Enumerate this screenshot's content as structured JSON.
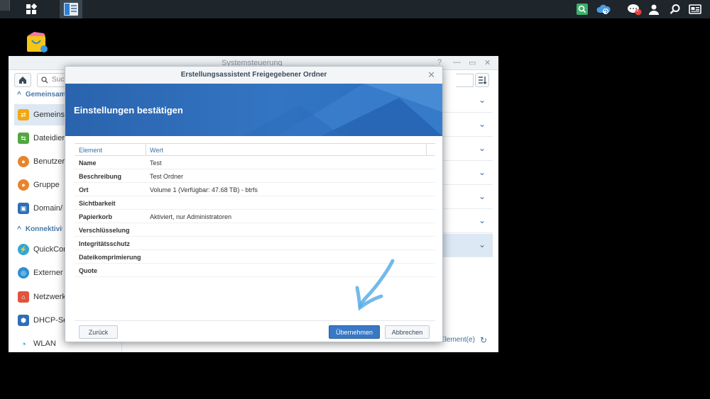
{
  "taskbar": {
    "apps_icon": "grid-icon",
    "control_panel_icon": "control-panel-icon",
    "notification_count": "1",
    "right_icons": [
      "search-app-icon",
      "cloud-sync-icon",
      "notifications-icon",
      "user-icon",
      "search-icon",
      "widgets-icon"
    ]
  },
  "window": {
    "title": "Systemsteuerung",
    "search_placeholder": "Suchen",
    "sidebar": {
      "categories": [
        "Gemeinsamer Dateizugriff",
        "Konnektivität"
      ],
      "items": [
        {
          "label": "Gemeinsamer Ordner",
          "icon": "shared-folder-icon",
          "color": "#f0a818"
        },
        {
          "label": "Dateidienste",
          "icon": "file-services-icon",
          "color": "#52a83c"
        },
        {
          "label": "Benutzer",
          "icon": "user-icon",
          "color": "#e8842c"
        },
        {
          "label": "Gruppe",
          "icon": "group-icon",
          "color": "#e8842c"
        },
        {
          "label": "Domain/LDAP",
          "icon": "domain-icon",
          "color": "#2d6fb8"
        },
        {
          "label": "QuickConnect",
          "icon": "quickconnect-icon",
          "color": "#2fa8d8"
        },
        {
          "label": "Externer Zugriff",
          "icon": "external-access-icon",
          "color": "#2d8fd0"
        },
        {
          "label": "Netzwerk",
          "icon": "network-icon",
          "color": "#e0543c"
        },
        {
          "label": "DHCP-Server",
          "icon": "dhcp-icon",
          "color": "#2d6fb8"
        },
        {
          "label": "WLAN",
          "icon": "wifi-icon",
          "color": "#2fa8d8"
        }
      ]
    },
    "footer_text": "Element(e)"
  },
  "dialog": {
    "title": "Erstellungsassistent Freigegebener Ordner",
    "heading": "Einstellungen bestätigen",
    "columns": [
      "Element",
      "Wert"
    ],
    "rows": [
      {
        "key": "Name",
        "value": "Test"
      },
      {
        "key": "Beschreibung",
        "value": "Test Ordner"
      },
      {
        "key": "Ort",
        "value": "Volume 1 (Verfügbar: 47.68 TB) - btrfs"
      },
      {
        "key": "Sichtbarkeit",
        "value": ""
      },
      {
        "key": "Papierkorb",
        "value": "Aktiviert, nur Administratoren"
      },
      {
        "key": "Verschlüsselung",
        "value": ""
      },
      {
        "key": "Integritätsschutz",
        "value": ""
      },
      {
        "key": "Dateikomprimierung",
        "value": ""
      },
      {
        "key": "Quote",
        "value": ""
      }
    ],
    "buttons": {
      "back": "Zurück",
      "apply": "Übernehmen",
      "cancel": "Abbrechen"
    }
  }
}
